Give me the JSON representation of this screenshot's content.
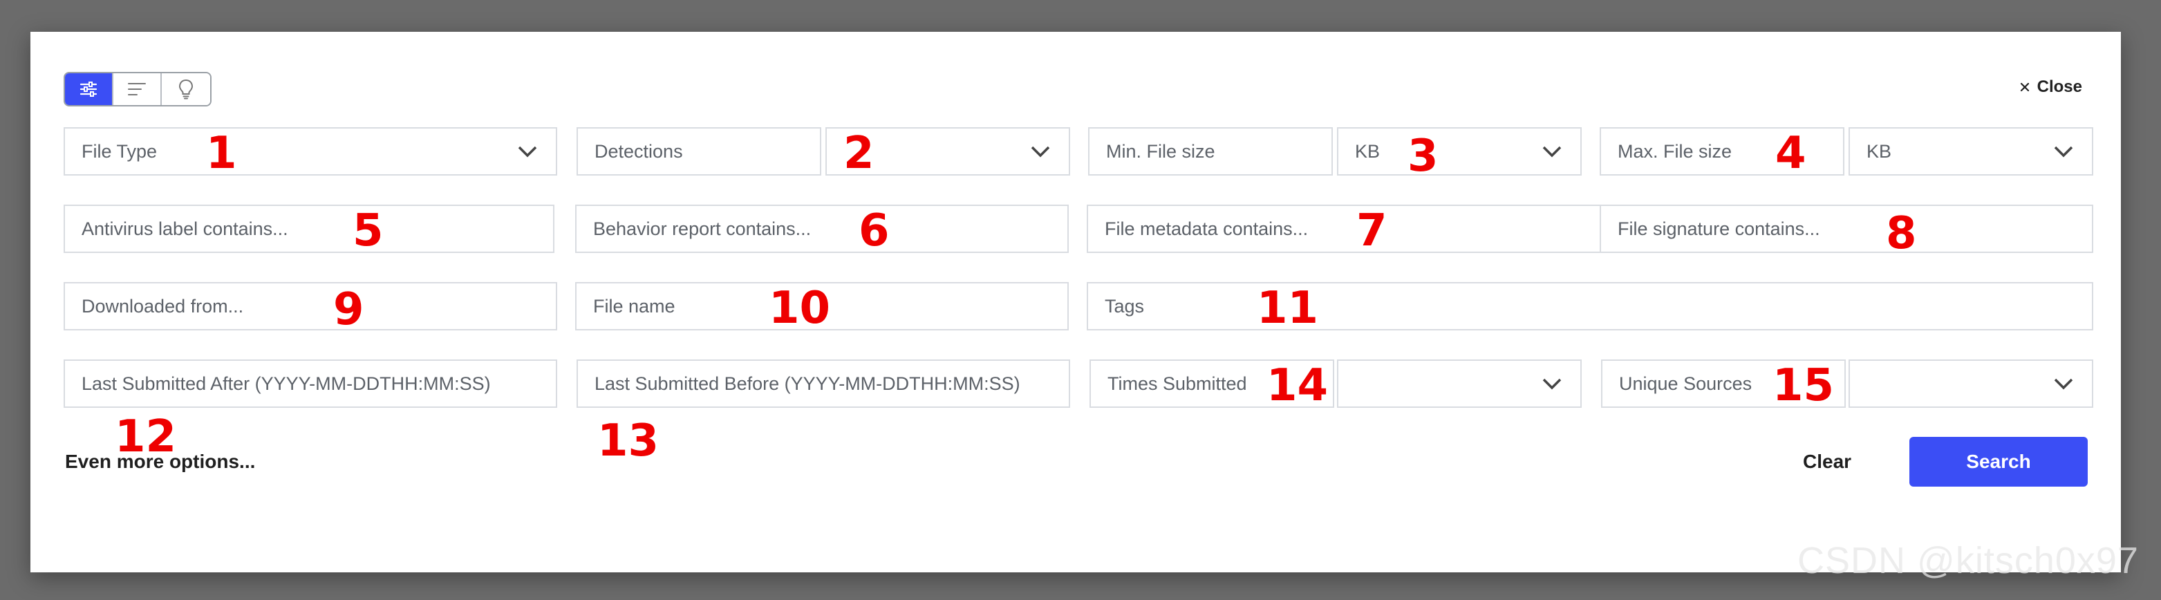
{
  "toolbar": {
    "modes": [
      {
        "icon": "sliders-icon",
        "active": true
      },
      {
        "icon": "text-lines-icon",
        "active": false
      },
      {
        "icon": "lightbulb-icon",
        "active": false
      }
    ],
    "close_label": "Close"
  },
  "fields": {
    "file_type": "File Type",
    "detections": "Detections",
    "detections_value": "",
    "min_file_size": "Min. File size",
    "min_unit": "KB",
    "max_file_size": "Max. File size",
    "max_unit": "KB",
    "antivirus": "Antivirus label contains...",
    "behavior": "Behavior report contains...",
    "metadata": "File metadata contains...",
    "signature": "File signature contains...",
    "downloaded": "Downloaded from...",
    "file_name": "File name",
    "tags": "Tags",
    "last_after": "Last Submitted After (YYYY-MM-DDTHH:MM:SS)",
    "last_before": "Last Submitted Before (YYYY-MM-DDTHH:MM:SS)",
    "times_submitted": "Times Submitted",
    "times_value": "",
    "unique_sources": "Unique Sources",
    "unique_value": ""
  },
  "annotations": [
    "1",
    "2",
    "3",
    "4",
    "5",
    "6",
    "7",
    "8",
    "9",
    "10",
    "11",
    "12",
    "13",
    "14",
    "15"
  ],
  "footer": {
    "more_options": "Even more options...",
    "clear": "Clear",
    "search": "Search"
  },
  "watermark": "CSDN @kitsch0x97",
  "colors": {
    "accent": "#3b4ef5",
    "annotation": "#ee0000",
    "backdrop": "#6b6b6b"
  }
}
